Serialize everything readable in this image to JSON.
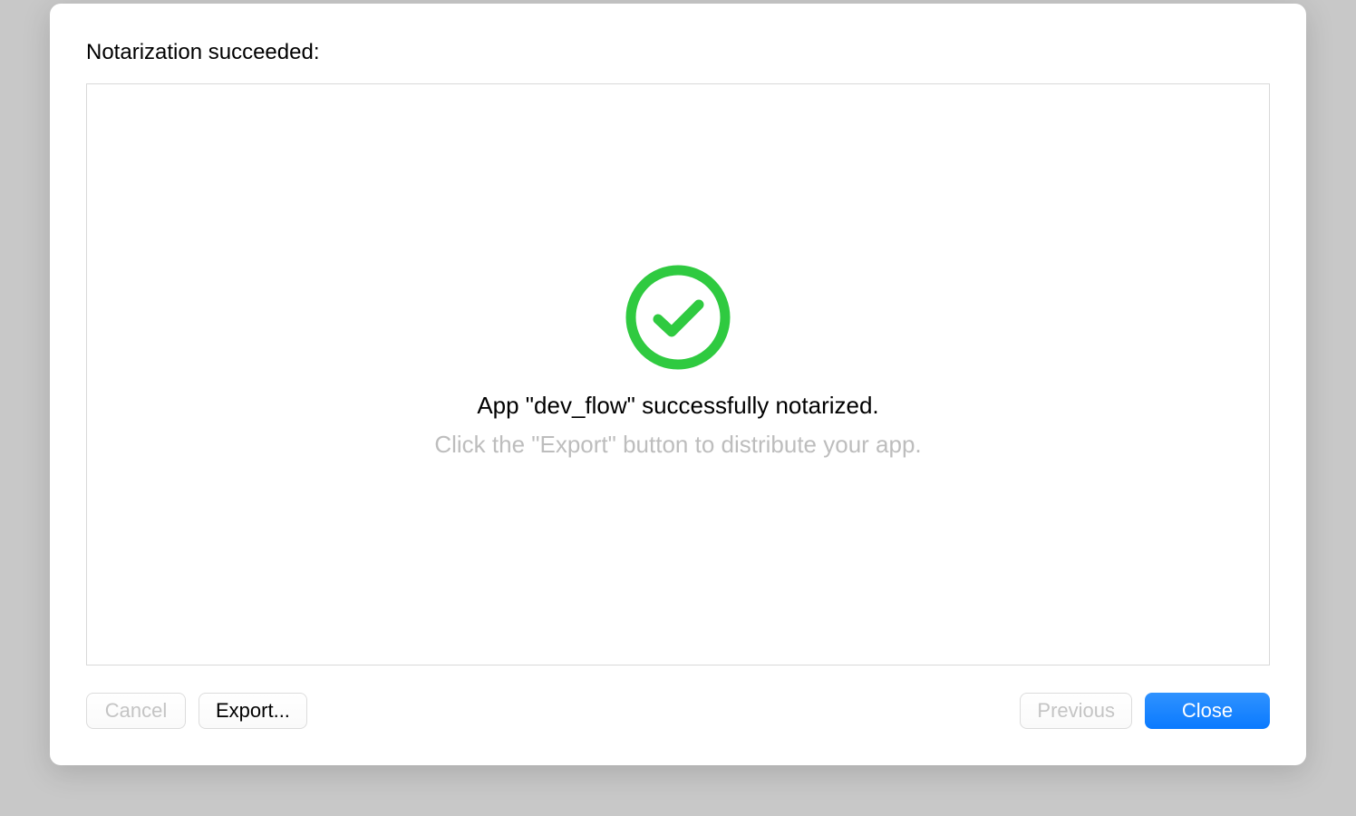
{
  "dialog": {
    "title": "Notarization succeeded:"
  },
  "content": {
    "success_message": "App \"dev_flow\" successfully notarized.",
    "hint_message": "Click the \"Export\" button to distribute your app."
  },
  "buttons": {
    "cancel": "Cancel",
    "export": "Export...",
    "previous": "Previous",
    "close": "Close"
  },
  "colors": {
    "success_green": "#2fca40",
    "primary_blue": "#0a7aff"
  }
}
